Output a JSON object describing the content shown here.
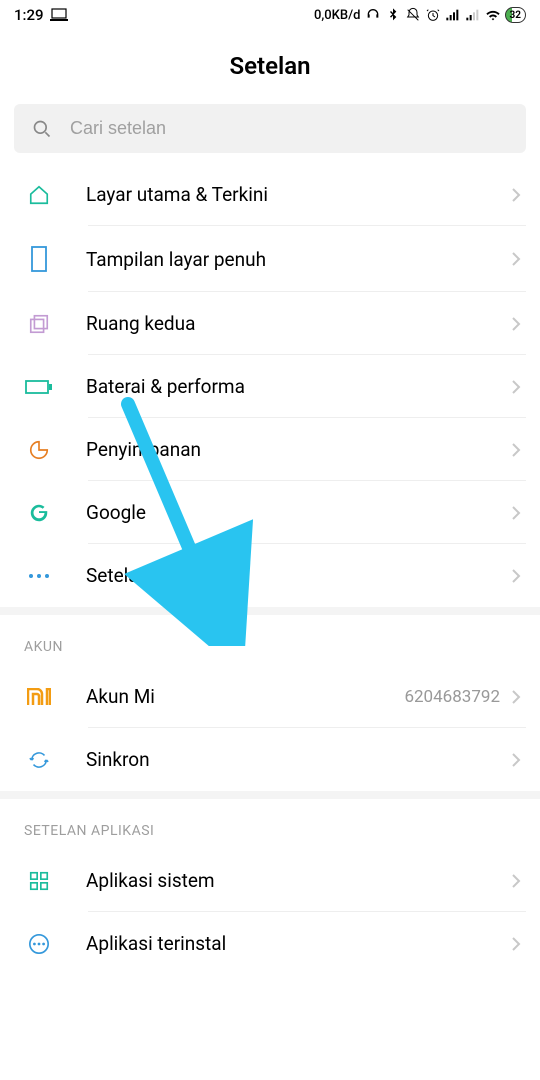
{
  "status": {
    "time": "1:29",
    "data_rate": "0,0KB/d",
    "battery_pct": "32"
  },
  "header": {
    "title": "Setelan"
  },
  "search": {
    "placeholder": "Cari setelan"
  },
  "items": [
    {
      "label": "Layar utama & Terkini",
      "icon": "home",
      "color": "#1abc9c"
    },
    {
      "label": "Tampilan layar penuh",
      "icon": "rect",
      "color": "#3498db"
    },
    {
      "label": "Ruang kedua",
      "icon": "dual",
      "color": "#c39bd3"
    },
    {
      "label": "Baterai & performa",
      "icon": "battery",
      "color": "#1abc9c"
    },
    {
      "label": "Penyimpanan",
      "icon": "storage",
      "color": "#e67e22"
    },
    {
      "label": "Google",
      "icon": "google",
      "color": "#1abc9c"
    },
    {
      "label": "Setelan tambahan",
      "icon": "dots",
      "color": "#3498db"
    }
  ],
  "section_akun": {
    "header": "AKUN",
    "items": [
      {
        "label": "Akun Mi",
        "value": "6204683792",
        "icon": "mi",
        "color": "#f39c12"
      },
      {
        "label": "Sinkron",
        "icon": "sync",
        "color": "#3498db"
      }
    ]
  },
  "section_app": {
    "header": "SETELAN APLIKASI",
    "items": [
      {
        "label": "Aplikasi sistem",
        "icon": "grid",
        "color": "#1abc9c"
      },
      {
        "label": "Aplikasi terinstal",
        "icon": "more-circle",
        "color": "#3498db"
      }
    ]
  }
}
